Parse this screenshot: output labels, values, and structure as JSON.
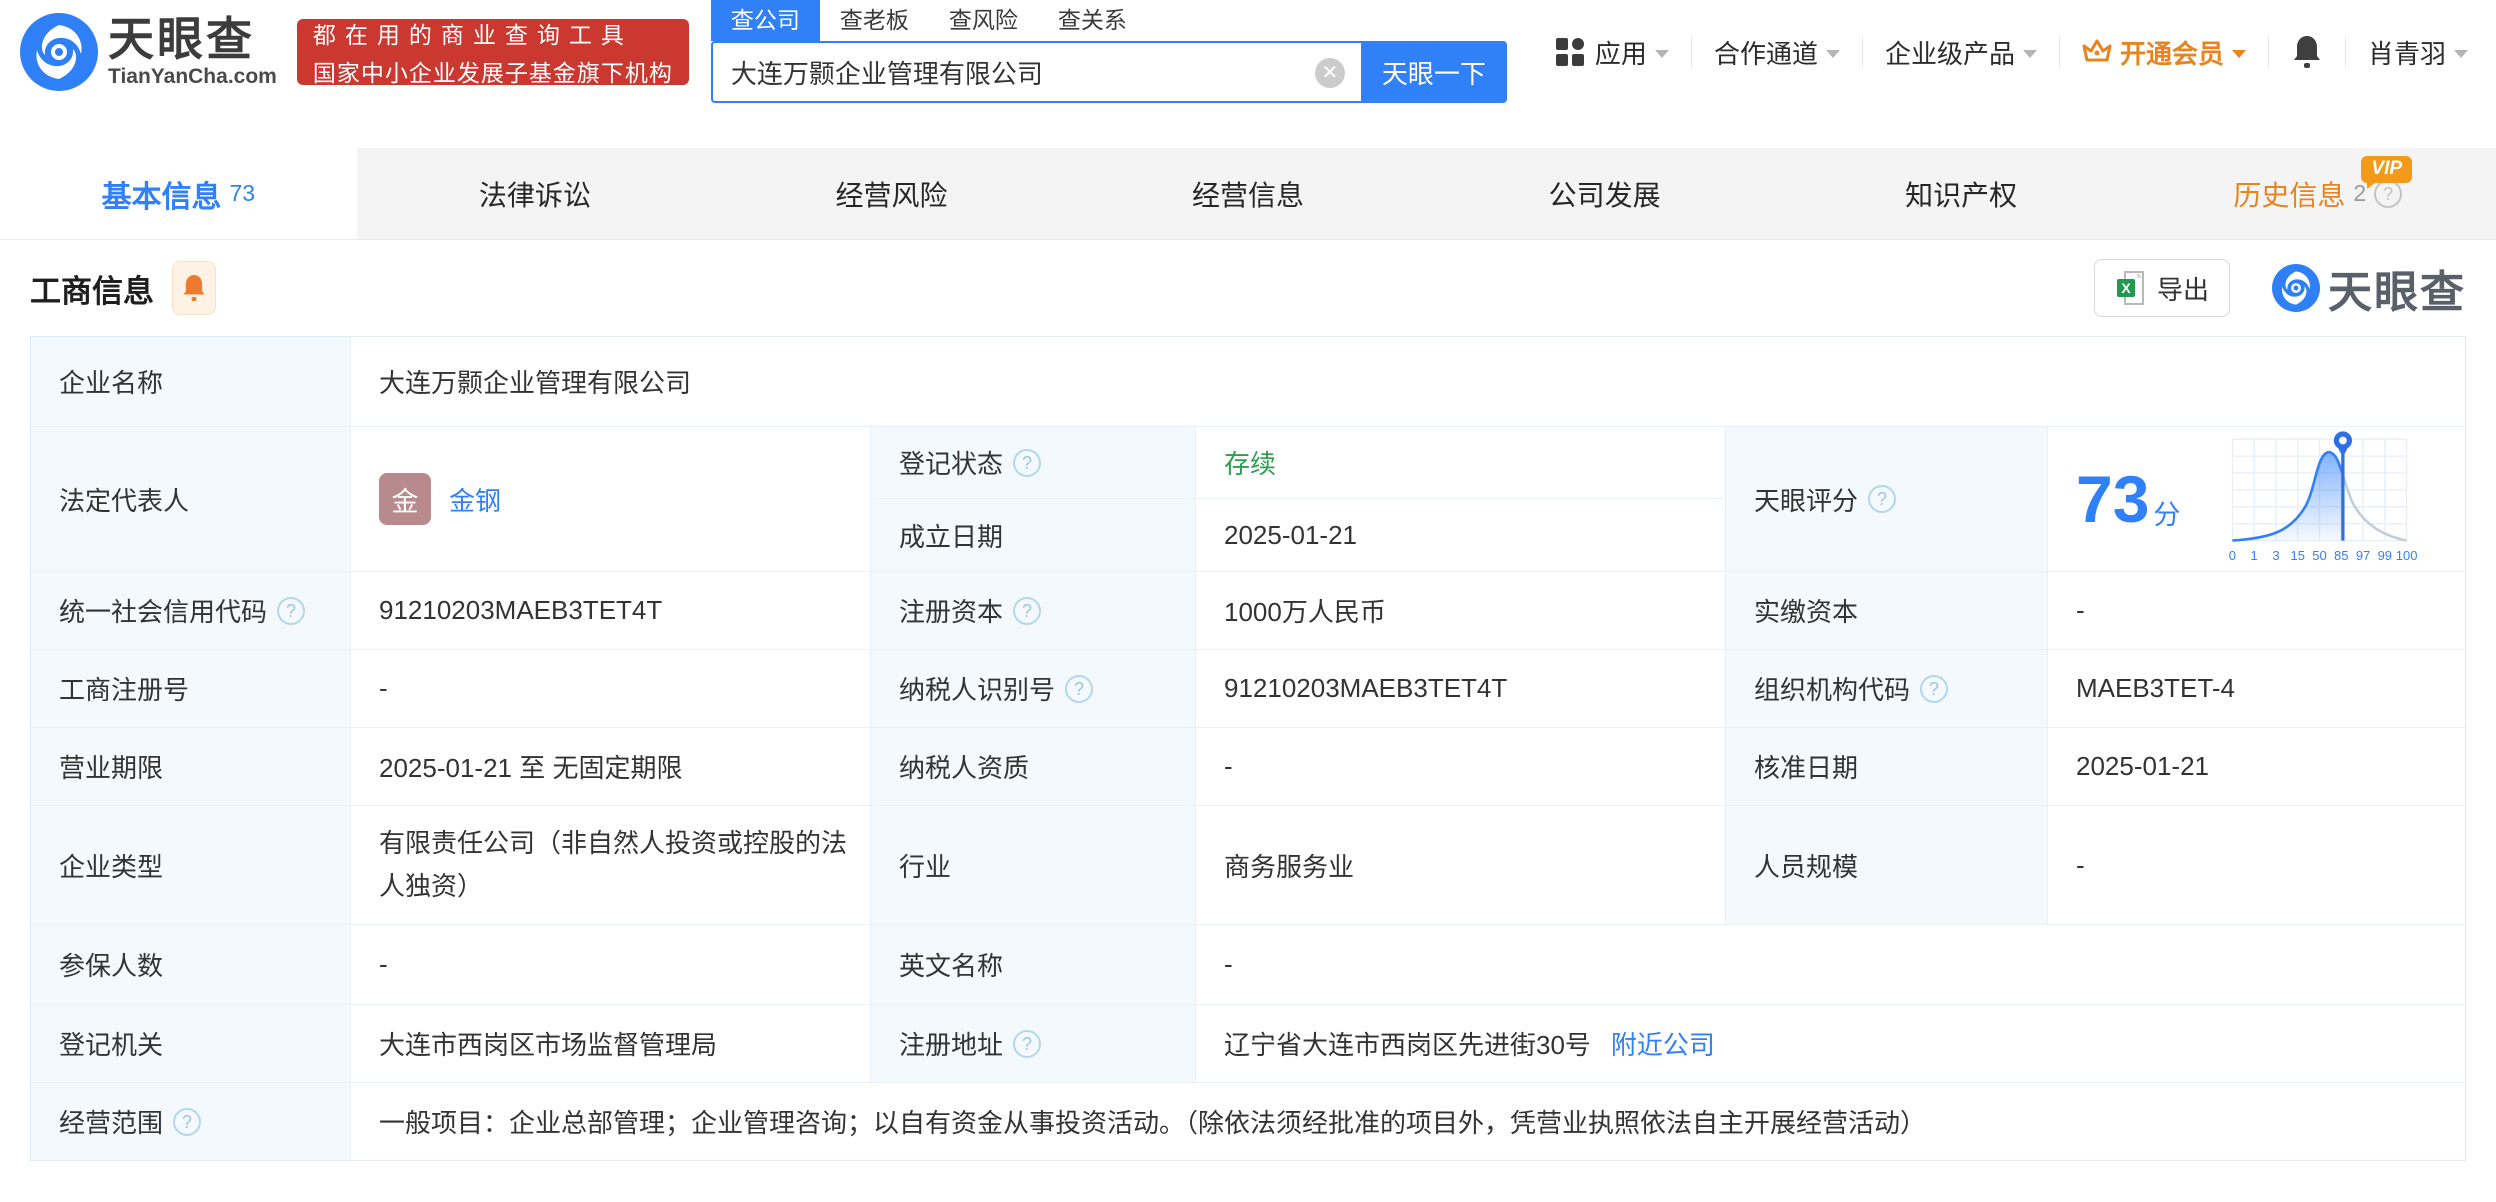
{
  "brand": {
    "name": "天眼查",
    "domain": "TianYanCha.com",
    "slogan_line1": "都在用的商业查询工具",
    "slogan_line2": "国家中小企业发展子基金旗下机构"
  },
  "search": {
    "tabs": [
      "查公司",
      "查老板",
      "查风险",
      "查关系"
    ],
    "value": "大连万颢企业管理有限公司",
    "button": "天眼一下"
  },
  "nav": {
    "apps": "应用",
    "cooperation": "合作通道",
    "enterprise": "企业级产品",
    "vip": "开通会员",
    "user": "肖青羽"
  },
  "tabs": {
    "basic": "基本信息",
    "basic_count": "73",
    "legal": "法律诉讼",
    "risk": "经营风险",
    "operation": "经营信息",
    "development": "公司发展",
    "ip": "知识产权",
    "history": "历史信息",
    "history_count": "2",
    "vip_badge": "VIP"
  },
  "section": {
    "title": "工商信息",
    "export": "导出",
    "watermark": "天眼查"
  },
  "score": {
    "value": "73",
    "unit": "分",
    "axis": [
      "0",
      "1",
      "3",
      "15",
      "50",
      "85",
      "97",
      "99",
      "100"
    ]
  },
  "fields": {
    "company_name": {
      "label": "企业名称",
      "value": "大连万颢企业管理有限公司"
    },
    "legal_rep": {
      "label": "法定代表人",
      "avatar_char": "金",
      "name": "金钢"
    },
    "reg_status": {
      "label": "登记状态",
      "value": "存续"
    },
    "establish_date": {
      "label": "成立日期",
      "value": "2025-01-21"
    },
    "score_label": {
      "label": "天眼评分"
    },
    "credit_code": {
      "label": "统一社会信用代码",
      "value": "91210203MAEB3TET4T"
    },
    "reg_capital": {
      "label": "注册资本",
      "value": "1000万人民币"
    },
    "paid_capital": {
      "label": "实缴资本",
      "value": "-"
    },
    "reg_number": {
      "label": "工商注册号",
      "value": "-"
    },
    "taxpayer_id": {
      "label": "纳税人识别号",
      "value": "91210203MAEB3TET4T"
    },
    "org_code": {
      "label": "组织机构代码",
      "value": "MAEB3TET-4"
    },
    "business_term": {
      "label": "营业期限",
      "value": "2025-01-21 至 无固定期限"
    },
    "taxpayer_quali": {
      "label": "纳税人资质",
      "value": "-"
    },
    "approval_date": {
      "label": "核准日期",
      "value": "2025-01-21"
    },
    "company_type": {
      "label": "企业类型",
      "value": "有限责任公司（非自然人投资或控股的法人独资）"
    },
    "industry": {
      "label": "行业",
      "value": "商务服务业"
    },
    "staff_size": {
      "label": "人员规模",
      "value": "-"
    },
    "insured_count": {
      "label": "参保人数",
      "value": "-"
    },
    "english_name": {
      "label": "英文名称",
      "value": "-"
    },
    "reg_authority": {
      "label": "登记机关",
      "value": "大连市西岗区市场监督管理局"
    },
    "reg_address": {
      "label": "注册地址",
      "value": "辽宁省大连市西岗区先进街30号",
      "link": "附近公司"
    },
    "business_scope": {
      "label": "经营范围",
      "value": "一般项目：企业总部管理；企业管理咨询；以自有资金从事投资活动。（除依法须经批准的项目外，凭营业执照依法自主开展经营活动）"
    }
  },
  "colors": {
    "primary": "#3080f8",
    "orange": "#e8831f",
    "green": "#2ca04e",
    "banner_red": "#ca382f"
  }
}
